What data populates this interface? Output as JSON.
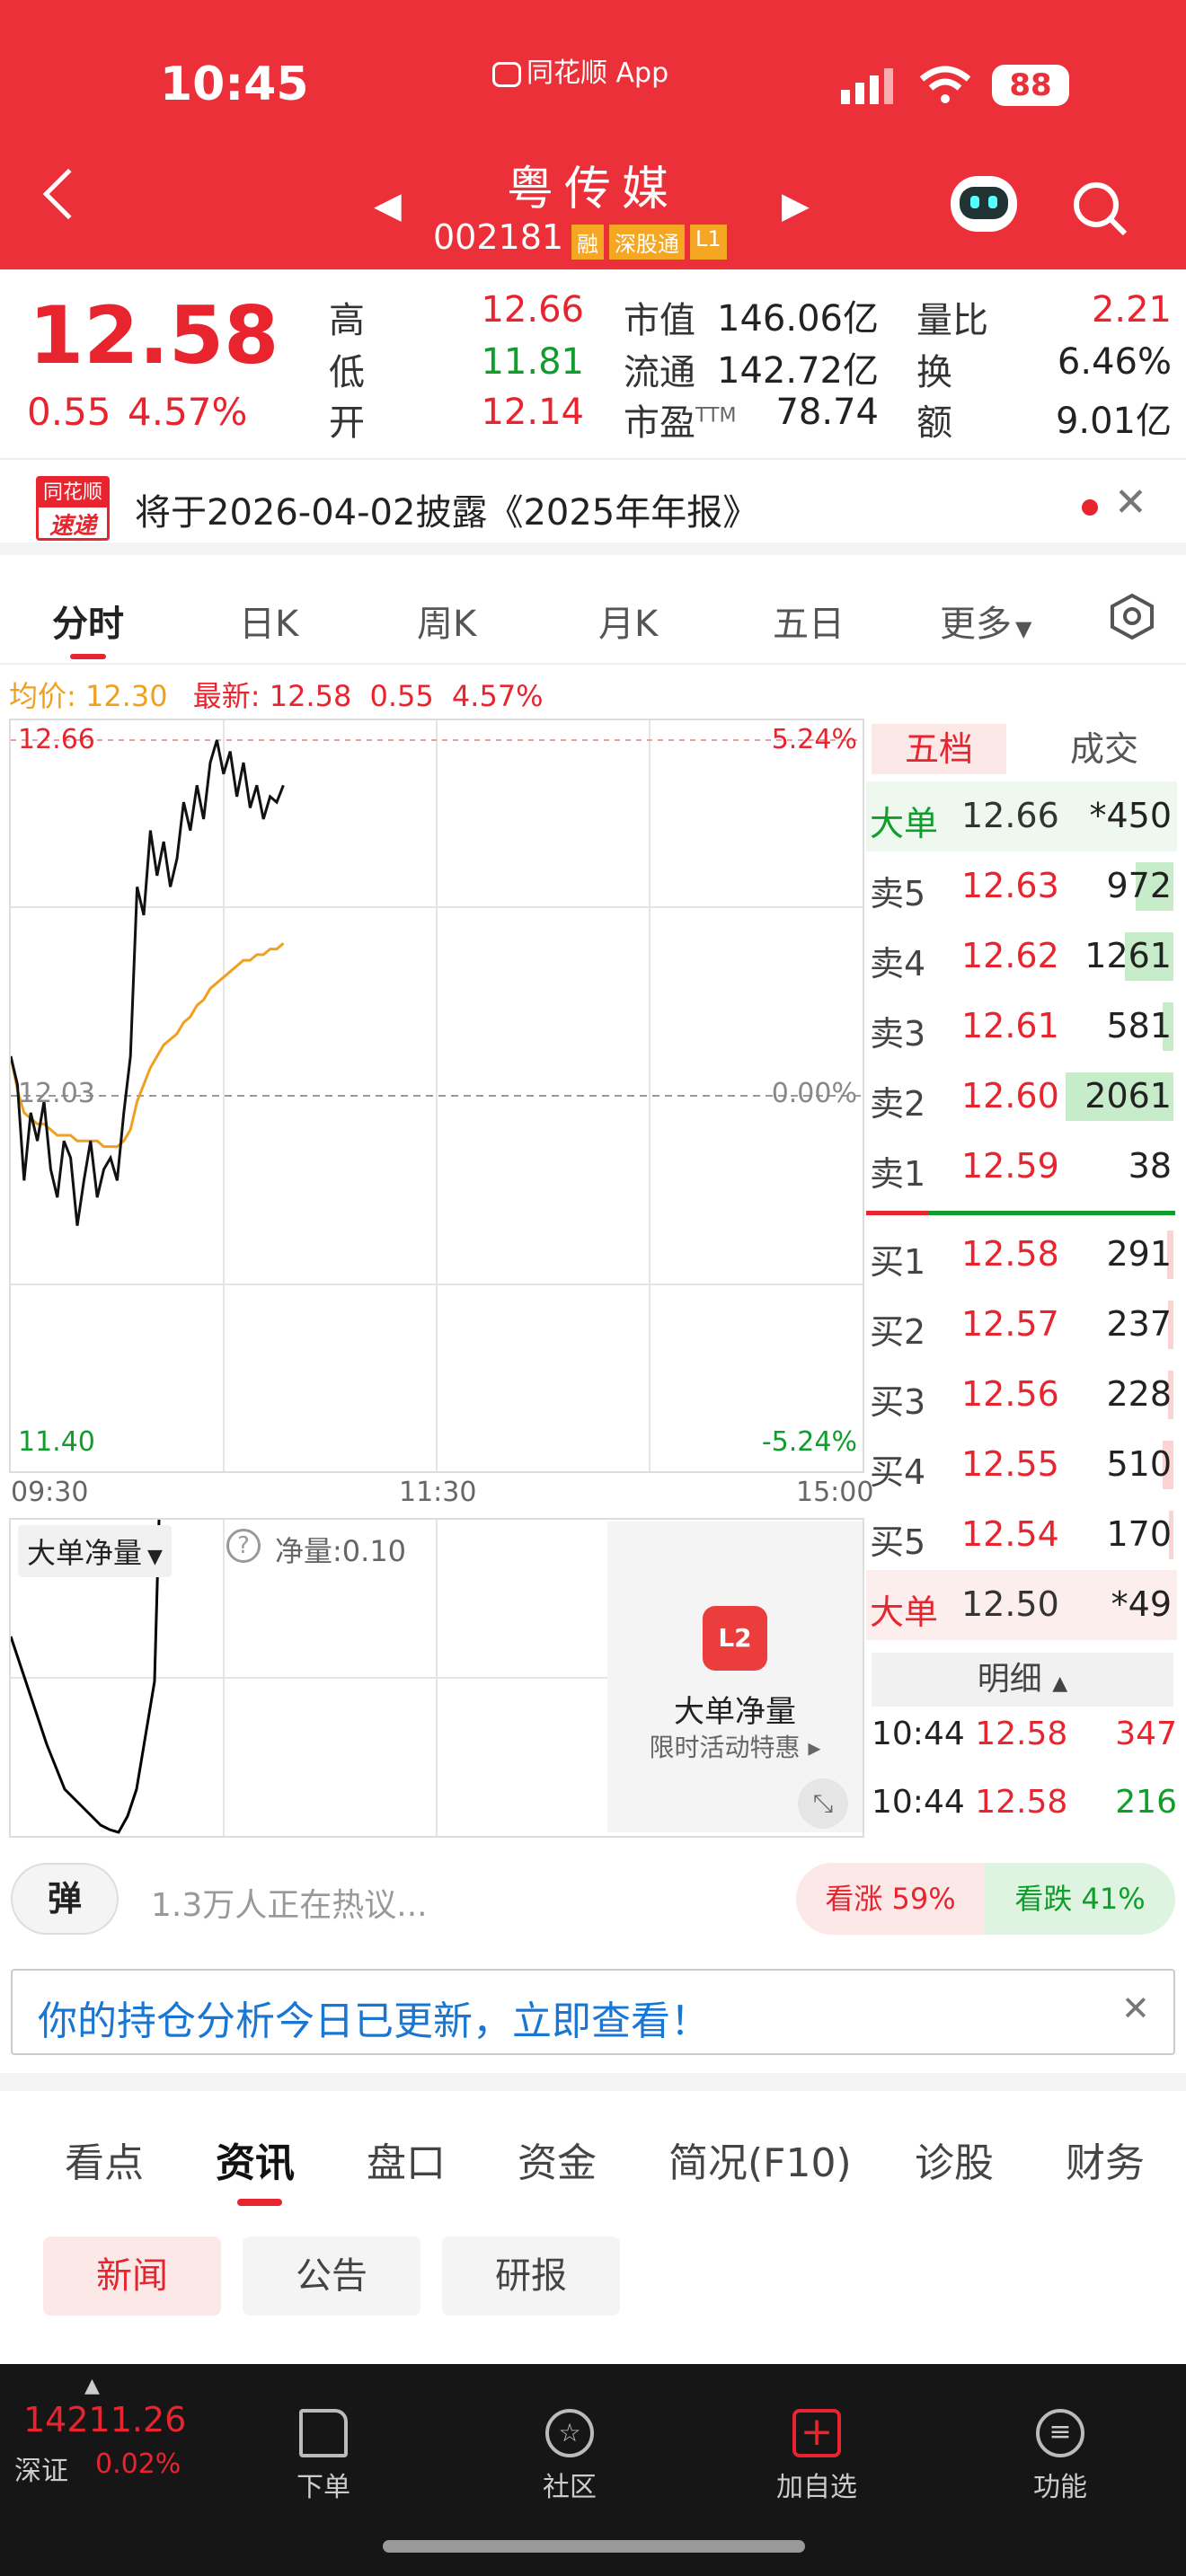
{
  "status_bar": {
    "time": "10:45",
    "app": "同花顺 App",
    "battery": "88"
  },
  "header": {
    "stock_name": "粤传媒",
    "stock_code": "002181",
    "tags": [
      "融",
      "深股通",
      "L1"
    ]
  },
  "quote": {
    "price": "12.58",
    "change": "0.55",
    "change_pct": "4.57%",
    "items": [
      {
        "label": "高",
        "value": "12.66"
      },
      {
        "label": "低",
        "value": "11.81"
      },
      {
        "label": "开",
        "value": "12.14"
      },
      {
        "label": "市值",
        "value": "146.06亿"
      },
      {
        "label": "流通",
        "value": "142.72亿"
      },
      {
        "label": "市盈",
        "sup": "TTM",
        "value": "78.74"
      },
      {
        "label": "量比",
        "value": "2.21"
      },
      {
        "label": "换",
        "value": "6.46%"
      },
      {
        "label": "额",
        "value": "9.01亿"
      }
    ]
  },
  "notice": {
    "logo_top": "同花顺",
    "logo_bottom": "速递",
    "text": "将于2026-04-02披露《2025年年报》"
  },
  "chart_tabs": [
    "分时",
    "日K",
    "周K",
    "月K",
    "五日",
    "更多"
  ],
  "chart_info": {
    "avg_label": "均价: 12.30",
    "latest_label": "最新: 12.58",
    "change": "0.55",
    "change_pct": "4.57%"
  },
  "chart_data": {
    "type": "line",
    "y_axis": {
      "top": "12.66",
      "mid": "12.03",
      "bottom": "11.40",
      "right_top": "5.24%",
      "right_mid": "0.00%",
      "right_bottom": "-5.24%"
    },
    "x_axis": [
      "09:30",
      "11:30",
      "15:00"
    ],
    "ylim": [
      11.4,
      12.66
    ],
    "price": [
      12.1,
      12.05,
      11.88,
      12.0,
      11.95,
      12.02,
      11.9,
      11.85,
      11.95,
      11.92,
      11.8,
      11.88,
      11.95,
      11.85,
      11.9,
      11.92,
      11.88,
      12.0,
      12.1,
      12.4,
      12.35,
      12.5,
      12.42,
      12.48,
      12.4,
      12.45,
      12.55,
      12.5,
      12.58,
      12.52,
      12.62,
      12.66,
      12.6,
      12.64,
      12.56,
      12.62,
      12.54,
      12.58,
      12.52,
      12.56,
      12.55,
      12.58
    ],
    "avg": [
      12.1,
      12.04,
      12.0,
      11.99,
      11.98,
      11.98,
      11.97,
      11.96,
      11.96,
      11.96,
      11.95,
      11.95,
      11.95,
      11.95,
      11.94,
      11.94,
      11.94,
      11.95,
      11.97,
      12.02,
      12.05,
      12.08,
      12.1,
      12.12,
      12.13,
      12.14,
      12.16,
      12.17,
      12.19,
      12.2,
      12.22,
      12.23,
      12.24,
      12.25,
      12.26,
      12.27,
      12.27,
      12.28,
      12.28,
      12.29,
      12.29,
      12.3
    ]
  },
  "orderbook": {
    "tabs": [
      "五档",
      "成交"
    ],
    "big_sell": {
      "label": "大单",
      "price": "12.66",
      "vol": "*450"
    },
    "sells": [
      {
        "label": "卖5",
        "price": "12.63",
        "vol": "972",
        "bar": 0.35
      },
      {
        "label": "卖4",
        "price": "12.62",
        "vol": "1261",
        "bar": 0.45
      },
      {
        "label": "卖3",
        "price": "12.61",
        "vol": "581",
        "bar": 0.1
      },
      {
        "label": "卖2",
        "price": "12.60",
        "vol": "2061",
        "bar": 1.0
      },
      {
        "label": "卖1",
        "price": "12.59",
        "vol": "38",
        "bar": 0.0
      }
    ],
    "buys": [
      {
        "label": "买1",
        "price": "12.58",
        "vol": "291",
        "bar": 0.06
      },
      {
        "label": "买2",
        "price": "12.57",
        "vol": "237",
        "bar": 0.05
      },
      {
        "label": "买3",
        "price": "12.56",
        "vol": "228",
        "bar": 0.05
      },
      {
        "label": "买4",
        "price": "12.55",
        "vol": "510",
        "bar": 0.1
      },
      {
        "label": "买5",
        "price": "12.54",
        "vol": "170",
        "bar": 0.04
      }
    ],
    "big_buy": {
      "label": "大单",
      "price": "12.50",
      "vol": "*49"
    },
    "detail_label": "明细",
    "trades": [
      {
        "time": "10:44",
        "price": "12.58",
        "vol": "347"
      },
      {
        "time": "10:44",
        "price": "12.58",
        "vol": "216"
      }
    ]
  },
  "volume_panel": {
    "dropdown": "大单净量",
    "net_label": "净量:0.10",
    "promo_title": "大单净量",
    "promo_sub": "限时活动特惠",
    "l2_badge": "L2"
  },
  "discussion": {
    "danmu": "弹",
    "text": "1.3万人正在热议...",
    "up": "看涨 59%",
    "down": "看跌 41%"
  },
  "banner": {
    "text": "你的持仓分析今日已更新，立即查看！"
  },
  "news_tabs": [
    "看点",
    "资讯",
    "盘口",
    "资金",
    "简况(F10)",
    "诊股",
    "财务"
  ],
  "sub_tabs": [
    "新闻",
    "公告",
    "研报"
  ],
  "bottom_bar": {
    "index_value": "14211.26",
    "index_name": "深证",
    "index_change": "0.02%",
    "items": [
      "下单",
      "社区",
      "加自选",
      "功能"
    ]
  }
}
